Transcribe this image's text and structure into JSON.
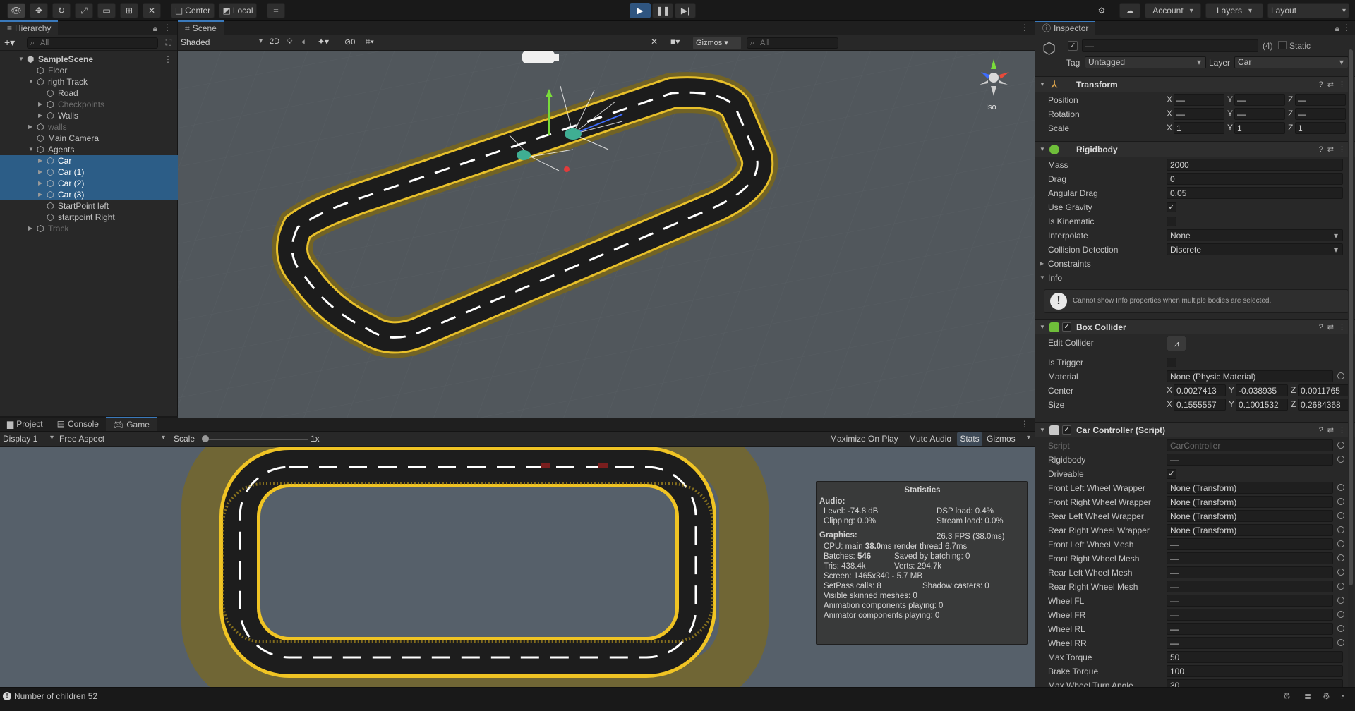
{
  "toolbar": {
    "pivot_label": "Center",
    "space_label": "Local",
    "account_label": "Account",
    "layers_label": "Layers",
    "layout_label": "Layout"
  },
  "hierarchy": {
    "tab_label": "Hierarchy",
    "search_placeholder": "All",
    "rows": [
      {
        "label": "SampleScene"
      },
      {
        "label": "Floor"
      },
      {
        "label": "rigth Track"
      },
      {
        "label": "Road"
      },
      {
        "label": "Checkpoints"
      },
      {
        "label": "Walls"
      },
      {
        "label": "walls"
      },
      {
        "label": "Main Camera"
      },
      {
        "label": "Agents"
      },
      {
        "label": "Car"
      },
      {
        "label": "Car (1)"
      },
      {
        "label": "Car (2)"
      },
      {
        "label": "Car (3)"
      },
      {
        "label": "StartPoint left"
      },
      {
        "label": "startpoint Right"
      },
      {
        "label": "Track"
      }
    ]
  },
  "scene": {
    "tab_label": "Scene",
    "shading_mode": "Shaded",
    "toggle_2d": "2D",
    "hidden_count": "0",
    "gizmos_label": "Gizmos",
    "search_placeholder": "All",
    "projection_label": "Iso"
  },
  "bottom": {
    "tabs": [
      {
        "label": "Project"
      },
      {
        "label": "Console"
      },
      {
        "label": "Game"
      }
    ],
    "display": "Display 1",
    "aspect": "Free Aspect",
    "scale_label": "Scale",
    "scale_value": "1x",
    "maximize_label": "Maximize On Play",
    "mute_label": "Mute Audio",
    "stats_label": "Stats",
    "gizmos_label": "Gizmos"
  },
  "stats": {
    "title": "Statistics",
    "audio_heading": "Audio:",
    "level": "Level: -74.8 dB",
    "dsp": "DSP load: 0.4%",
    "clipping": "Clipping: 0.0%",
    "stream": "Stream load: 0.0%",
    "graphics_heading": "Graphics:",
    "fps": "26.3 FPS (38.0ms)",
    "cpu_prefix": "CPU: main ",
    "cpu_main": "38.0",
    "cpu_suffix": "ms  render thread 6.7ms",
    "batches_prefix": "Batches: ",
    "batches": "546",
    "saved_batching": "Saved by batching: 0",
    "tris": "Tris: 438.4k",
    "verts": "Verts: 294.7k",
    "screen": "Screen: 1465x340 - 5.7 MB",
    "setpass": "SetPass calls: 8",
    "shadow_casters": "Shadow casters: 0",
    "skinned": "Visible skinned meshes: 0",
    "animation": "Animation components playing: 0",
    "animator": "Animator components playing: 0"
  },
  "inspector": {
    "tab_label": "Inspector",
    "object_name": "—",
    "object_count": "(4)",
    "static_label": "Static",
    "tag_label": "Tag",
    "tag_value": "Untagged",
    "layer_label": "Layer",
    "layer_value": "Car",
    "transform": {
      "title": "Transform",
      "position_label": "Position",
      "rotation_label": "Rotation",
      "scale_label": "Scale",
      "position": [
        "—",
        "—",
        "—"
      ],
      "rotation": [
        "—",
        "—",
        "—"
      ],
      "scale": [
        "1",
        "1",
        "1"
      ]
    },
    "rigidbody": {
      "title": "Rigidbody",
      "mass_label": "Mass",
      "mass": "2000",
      "drag_label": "Drag",
      "drag": "0",
      "angular_drag_label": "Angular Drag",
      "angular_drag": "0.05",
      "use_gravity_label": "Use Gravity",
      "is_kinematic_label": "Is Kinematic",
      "interpolate_label": "Interpolate",
      "interpolate": "None",
      "collision_label": "Collision Detection",
      "collision": "Discrete",
      "constraints_label": "Constraints",
      "info_label": "Info",
      "info_message": "Cannot show Info properties when multiple bodies are selected."
    },
    "box_collider": {
      "title": "Box Collider",
      "edit_label": "Edit Collider",
      "is_trigger_label": "Is Trigger",
      "material_label": "Material",
      "material": "None (Physic Material)",
      "center_label": "Center",
      "center": [
        "0.0027413",
        "-0.038935",
        "0.0011765"
      ],
      "size_label": "Size",
      "size": [
        "0.1555557",
        "0.1001532",
        "0.2684368"
      ]
    },
    "car_controller": {
      "title": "Car Controller (Script)",
      "script_label": "Script",
      "script": "CarController",
      "rigidbody_label": "Rigidbody",
      "rigidbody": "—",
      "driveable_label": "Driveable",
      "fields": [
        {
          "label": "Front Left Wheel Wrapper",
          "value": "None (Transform)"
        },
        {
          "label": "Front Right Wheel Wrapper",
          "value": "None (Transform)"
        },
        {
          "label": "Rear Left Wheel Wrapper",
          "value": "None (Transform)"
        },
        {
          "label": "Rear Right Wheel Wrapper",
          "value": "None (Transform)"
        },
        {
          "label": "Front Left Wheel Mesh",
          "value": "—"
        },
        {
          "label": "Front Right Wheel Mesh",
          "value": "—"
        },
        {
          "label": "Rear Left Wheel Mesh",
          "value": "—"
        },
        {
          "label": "Rear Right Wheel Mesh",
          "value": "—"
        },
        {
          "label": "Wheel FL",
          "value": "—"
        },
        {
          "label": "Wheel FR",
          "value": "—"
        },
        {
          "label": "Wheel RL",
          "value": "—"
        },
        {
          "label": "Wheel RR",
          "value": "—"
        }
      ],
      "max_torque_label": "Max Torque",
      "max_torque": "50",
      "brake_torque_label": "Brake Torque",
      "brake_torque": "100",
      "max_turn_label": "Max Wheel Turn Angle",
      "max_turn": "30"
    }
  },
  "status": {
    "message": "Number of children 52"
  }
}
